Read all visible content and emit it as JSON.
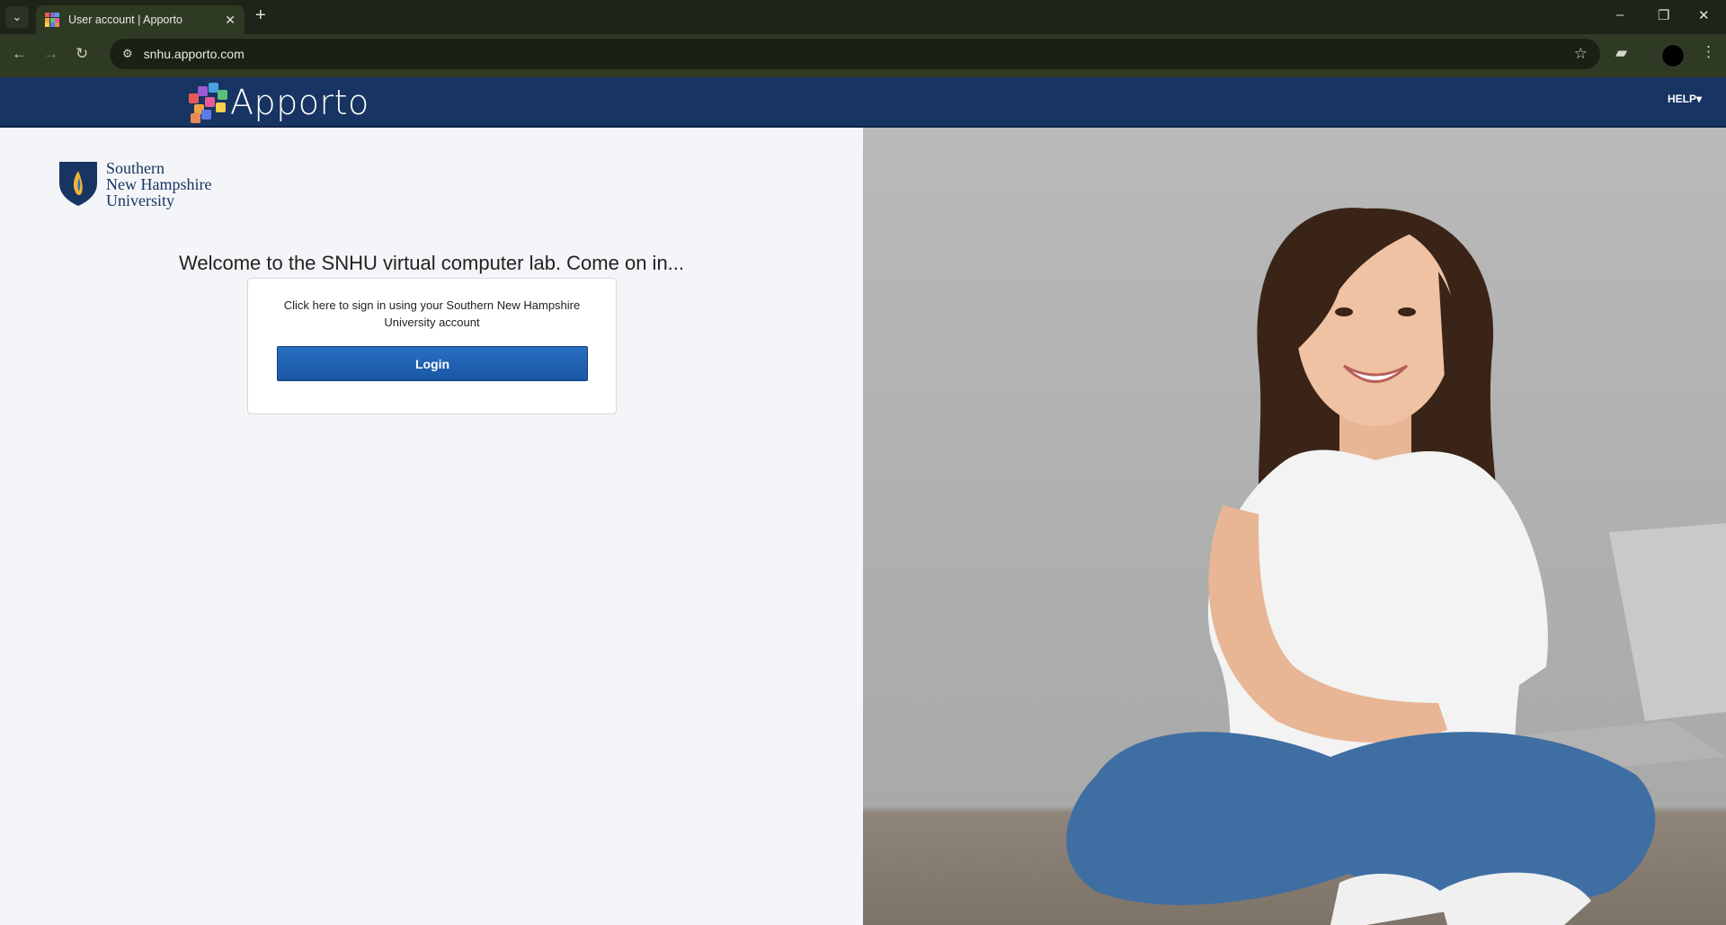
{
  "browser": {
    "tab_title": "User account | Apporto",
    "url": "snhu.apporto.com",
    "icons": {
      "tab_list": "chevron-down-icon",
      "close": "close-icon",
      "new_tab": "plus-icon",
      "back": "back-arrow-icon",
      "forward": "forward-arrow-icon",
      "reload": "reload-icon",
      "site_info": "tune-icon",
      "bookmark": "star-icon",
      "extensions": "puzzle-icon",
      "menu": "kebab-menu-icon"
    }
  },
  "header": {
    "brand": "Apporto",
    "help_label": "HELP",
    "bg_color": "#173462"
  },
  "university": {
    "name_line1": "Southern",
    "name_line2": "New Hampshire",
    "name_line3": "University"
  },
  "main": {
    "welcome": "Welcome to the SNHU virtual computer lab. Come on in...",
    "card_text": "Click here to sign in using your Southern New Hampshire University account",
    "login_label": "Login",
    "login_color": "#1f5fb0"
  }
}
